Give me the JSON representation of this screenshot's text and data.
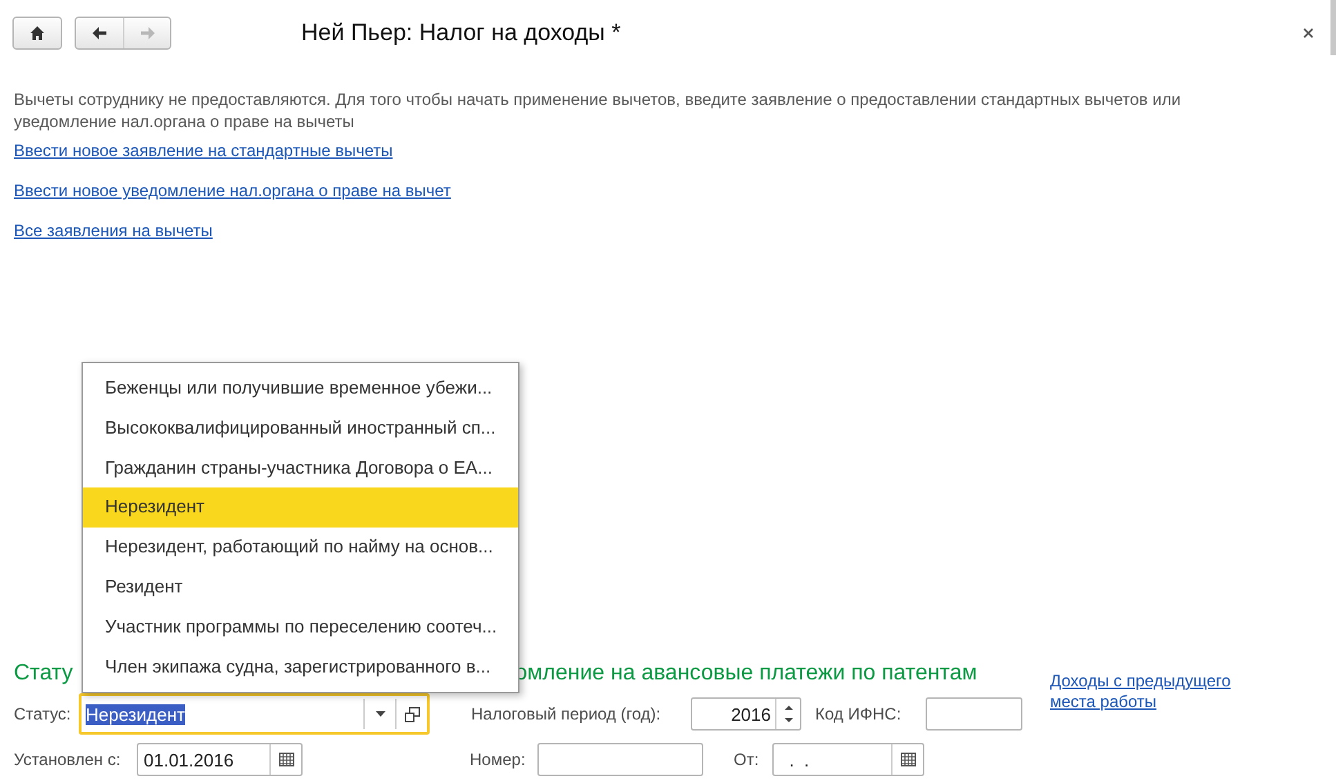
{
  "nav": {
    "buttons": [
      {
        "kind": "home",
        "disabled": false
      },
      {
        "kind": "back",
        "disabled": false
      },
      {
        "kind": "forward",
        "disabled": true
      }
    ]
  },
  "window": {
    "title": "Ней Пьер: Налог на доходы *"
  },
  "info_text": "Вычеты сотруднику не предоставляются. Для того чтобы начать применение вычетов, введите заявление о предоставлении стандартных вычетов или уведомление нал.органа о праве на вычеты",
  "links": [
    "Ввести новое заявление на стандартные вычеты",
    "Ввести новое уведомление нал.органа о праве на вычет",
    "Все заявления на вычеты"
  ],
  "section_heading": {
    "left_part": "Стату",
    "right_part": "омление на авансовые платежи по патентам"
  },
  "status_field": {
    "label": "Статус:",
    "value": "Нерезидент",
    "focused": true
  },
  "dropdown": {
    "items": [
      {
        "label": "Беженцы или получившие временное убежи...",
        "selected": false
      },
      {
        "label": "Высококвалифицированный иностранный сп...",
        "selected": false
      },
      {
        "label": "Гражданин страны-участника Договора о ЕА...",
        "selected": false
      },
      {
        "label": "Нерезидент",
        "selected": true
      },
      {
        "label": "Нерезидент, работающий по найму на основ...",
        "selected": false
      },
      {
        "label": "Резидент",
        "selected": false
      },
      {
        "label": "Участник программы по переселению соотеч...",
        "selected": false
      },
      {
        "label": "Член экипажа судна, зарегистрированного в...",
        "selected": false
      }
    ]
  },
  "tax_period": {
    "label": "Налоговый период (год):",
    "value": "2016"
  },
  "ifns_code": {
    "label": "Код ИФНС:"
  },
  "income_link": "Доходы с предыдущего места работы",
  "established_from": {
    "label": "Установлен с:",
    "value": "01.01.2016"
  },
  "number": {
    "label": "Номер:"
  },
  "date_from": {
    "label": "От:",
    "value": "  .  ."
  }
}
